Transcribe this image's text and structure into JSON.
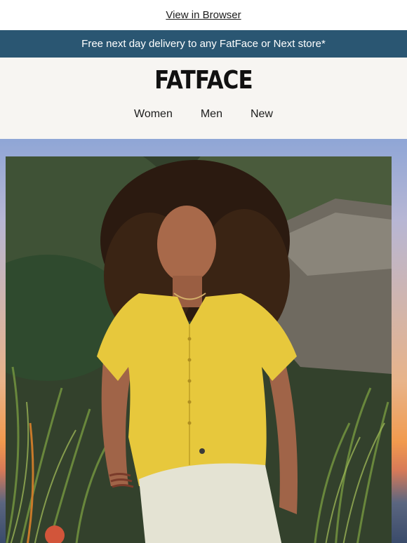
{
  "top": {
    "view_in_browser": "View in Browser"
  },
  "promo": {
    "text": "Free next day delivery to any FatFace or Next store*"
  },
  "header": {
    "logo": "FATFACE"
  },
  "nav": {
    "items": [
      {
        "label": "Women"
      },
      {
        "label": "Men"
      },
      {
        "label": "New"
      }
    ]
  },
  "colors": {
    "promo_bg": "#2a5672",
    "header_bg": "#f7f5f2",
    "shirt": "#e7c83c"
  }
}
